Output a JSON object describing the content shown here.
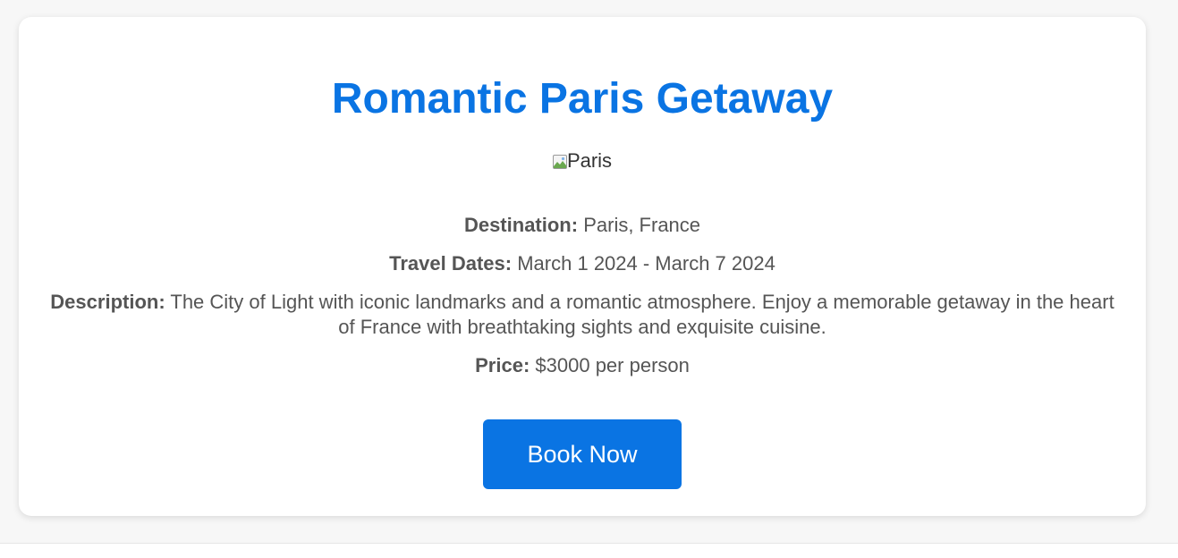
{
  "package": {
    "title": "Romantic Paris Getaway",
    "image_alt": "Paris",
    "destination_label": "Destination:",
    "destination_value": "Paris, France",
    "dates_label": "Travel Dates:",
    "dates_value": "March 1 2024 - March 7 2024",
    "description_label": "Description:",
    "description_value": "The City of Light with iconic landmarks and a romantic atmosphere. Enjoy a memorable getaway in the heart of France with breathtaking sights and exquisite cuisine.",
    "price_label": "Price:",
    "price_value": "$3000 per person",
    "book_button_label": "Book Now"
  },
  "colors": {
    "accent": "#0a74e3",
    "text": "#555555",
    "background": "#f7f7f7",
    "card": "#ffffff"
  },
  "icons": {
    "broken_image": "broken-image-icon"
  }
}
